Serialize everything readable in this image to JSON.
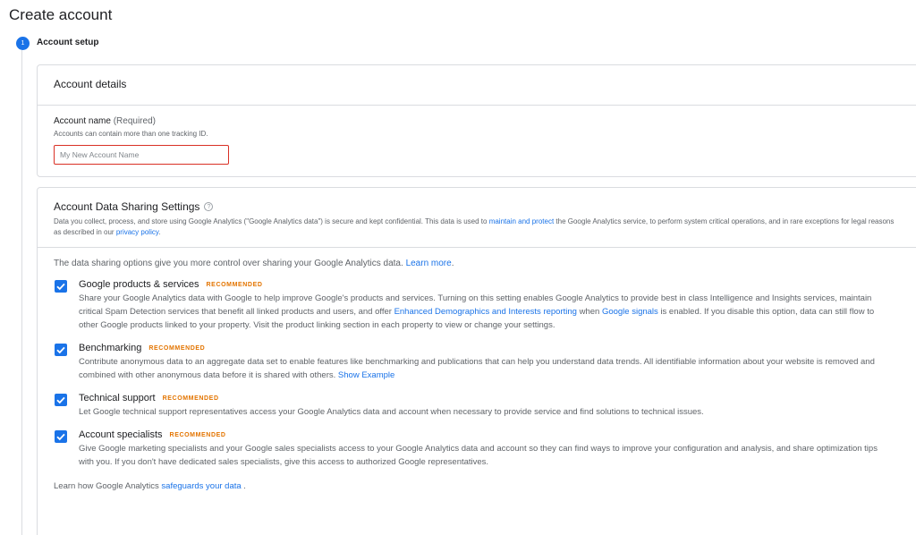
{
  "page": {
    "title": "Create account"
  },
  "stepper": {
    "step_number": "1",
    "step_label": "Account setup"
  },
  "account_details": {
    "header": "Account details",
    "name_label": "Account name",
    "name_required": "(Required)",
    "name_hint": "Accounts can contain more than one tracking ID.",
    "name_placeholder": "My New Account Name",
    "name_value": ""
  },
  "sharing": {
    "title": "Account Data Sharing Settings",
    "help_glyph": "?",
    "desc_part1": "Data you collect, process, and store using Google Analytics (\"Google Analytics data\") is secure and kept confidential. This data is used to ",
    "desc_link1": "maintain and protect",
    "desc_part2": " the Google Analytics service, to perform system critical operations, and in rare exceptions for legal reasons as described in our ",
    "desc_link2": "privacy policy",
    "desc_part3": ".",
    "intro_text": "The data sharing options give you more control over sharing your Google Analytics data. ",
    "intro_link": "Learn more",
    "intro_end": ".",
    "recommended": "RECOMMENDED",
    "options": [
      {
        "title": "Google products & services",
        "checked": true,
        "desc_part1": "Share your Google Analytics data with Google to help improve Google's products and services. Turning on this setting enables Google Analytics to provide best in class Intelligence and Insights services, maintain critical Spam Detection services that benefit all linked products and users, and offer ",
        "desc_link1": "Enhanced Demographics and Interests reporting",
        "desc_part2": " when ",
        "desc_link2": "Google signals",
        "desc_part3": " is enabled. If you disable this option, data can still flow to other Google products linked to your property. Visit the product linking section in each property to view or change your settings."
      },
      {
        "title": "Benchmarking",
        "checked": true,
        "desc_part1": "Contribute anonymous data to an aggregate data set to enable features like benchmarking and publications that can help you understand data trends. All identifiable information about your website is removed and combined with other anonymous data before it is shared with others. ",
        "desc_link1": "Show Example"
      },
      {
        "title": "Technical support",
        "checked": true,
        "desc_part1": "Let Google technical support representatives access your Google Analytics data and account when necessary to provide service and find solutions to technical issues."
      },
      {
        "title": "Account specialists",
        "checked": true,
        "desc_part1": "Give Google marketing specialists and your Google sales specialists access to your Google Analytics data and account so they can find ways to improve your configuration and analysis, and share optimization tips with you. If you don't have dedicated sales specialists, give this access to authorized Google representatives."
      }
    ],
    "footer_text": "Learn how Google Analytics ",
    "footer_link": "safeguards your data",
    "footer_end": " ."
  },
  "colors": {
    "accent": "#1a73e8",
    "recommended": "#e37400",
    "error_border": "#d93025"
  },
  "icons": {
    "checkbox": "check-icon",
    "help": "help-circle-icon"
  }
}
